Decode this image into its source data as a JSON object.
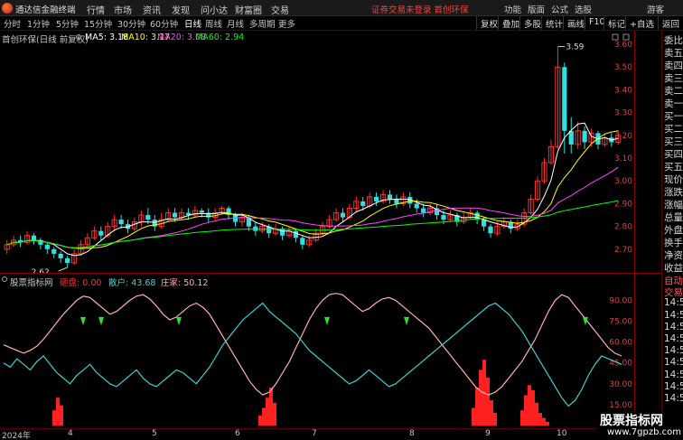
{
  "app": {
    "name": "通达信金融终端"
  },
  "menu": [
    "行情",
    "市场",
    "资讯",
    "发现",
    "问小达",
    "财富圈",
    "交易"
  ],
  "notice": "证券交易未登录  首创环保",
  "sys_buttons": [
    "功能",
    "版面",
    "公式",
    "选股",
    "游客"
  ],
  "periods": [
    "分时",
    "1分钟",
    "5分钟",
    "15分钟",
    "30分钟",
    "60分钟",
    "日线",
    "周线",
    "月线",
    "多周期",
    "更多"
  ],
  "active_period": "日线",
  "tools": [
    "复权",
    "叠加",
    "多股",
    "统计",
    "画线",
    "F10",
    "标记",
    "+自选",
    "返回"
  ],
  "stock": {
    "label": "首创环保(日线 前复权)"
  },
  "ma": [
    {
      "name": "MA5",
      "value": "3.18",
      "color": "#ffffff"
    },
    {
      "name": "MA10",
      "value": "3.17",
      "color": "#ffff00"
    },
    {
      "name": "MA20",
      "value": "3.08",
      "color": "#ff44ff"
    },
    {
      "name": "MA60",
      "value": "2.94",
      "color": "#00ff00"
    }
  ],
  "price_axis": [
    "3.60",
    "3.50",
    "3.40",
    "3.30",
    "3.20",
    "3.10",
    "3.00",
    "2.90",
    "2.80",
    "2.70"
  ],
  "annotations": {
    "high": "3.59",
    "low": "2.62"
  },
  "indicator": {
    "name": "股票指标网",
    "items": [
      {
        "name": "砸盘",
        "value": "0.00",
        "color": "#ff3030"
      },
      {
        "name": "散户",
        "value": "43.68",
        "color": "#40d0d0"
      },
      {
        "name": "庄家",
        "value": "50.12",
        "color": "#ffb0b0"
      }
    ],
    "axis": [
      "90.00",
      "75.00",
      "60.00",
      "45.00",
      "30.00",
      "15.00"
    ]
  },
  "right_column": [
    "委比",
    "卖五",
    "卖四",
    "卖三",
    "卖二",
    "卖一",
    "买一",
    "买二",
    "买三",
    "买四",
    "买五",
    "现价",
    "涨跌",
    "涨幅",
    "总量",
    "外盘",
    "换手",
    "净资",
    "收益",
    "自动",
    "交易",
    "14:50",
    "14:50",
    "14:50",
    "14:50",
    "14:50",
    "14:50",
    "14:50",
    "14:50",
    "14:50"
  ],
  "bottom": {
    "year": "2024年",
    "dates": [
      "4",
      "5",
      "6",
      "7",
      "8",
      "9",
      "10"
    ]
  },
  "watermark": {
    "title": "股票指标网",
    "url": "www.7gpzb.com"
  },
  "chart_data": {
    "type": "candlestick",
    "price_range": [
      2.62,
      3.62
    ],
    "high_label": 3.59,
    "low_label": 2.62,
    "candles": [
      [
        2.7,
        2.72,
        2.68,
        2.74
      ],
      [
        2.72,
        2.74,
        2.71,
        2.76
      ],
      [
        2.74,
        2.73,
        2.71,
        2.76
      ],
      [
        2.73,
        2.76,
        2.72,
        2.78
      ],
      [
        2.76,
        2.74,
        2.72,
        2.77
      ],
      [
        2.74,
        2.72,
        2.7,
        2.75
      ],
      [
        2.72,
        2.7,
        2.68,
        2.73
      ],
      [
        2.7,
        2.68,
        2.66,
        2.71
      ],
      [
        2.68,
        2.66,
        2.64,
        2.69
      ],
      [
        2.66,
        2.64,
        2.62,
        2.67
      ],
      [
        2.64,
        2.68,
        2.63,
        2.7
      ],
      [
        2.68,
        2.72,
        2.67,
        2.74
      ],
      [
        2.72,
        2.75,
        2.71,
        2.77
      ],
      [
        2.75,
        2.78,
        2.74,
        2.8
      ],
      [
        2.78,
        2.76,
        2.74,
        2.8
      ],
      [
        2.76,
        2.8,
        2.75,
        2.82
      ],
      [
        2.8,
        2.83,
        2.78,
        2.85
      ],
      [
        2.83,
        2.81,
        2.79,
        2.85
      ],
      [
        2.81,
        2.79,
        2.77,
        2.83
      ],
      [
        2.79,
        2.82,
        2.78,
        2.84
      ],
      [
        2.82,
        2.85,
        2.8,
        2.87
      ],
      [
        2.85,
        2.83,
        2.81,
        2.88
      ],
      [
        2.83,
        2.8,
        2.78,
        2.85
      ],
      [
        2.8,
        2.83,
        2.79,
        2.86
      ],
      [
        2.83,
        2.86,
        2.82,
        2.88
      ],
      [
        2.86,
        2.84,
        2.82,
        2.88
      ],
      [
        2.84,
        2.86,
        2.83,
        2.88
      ],
      [
        2.86,
        2.85,
        2.83,
        2.88
      ],
      [
        2.85,
        2.87,
        2.84,
        2.89
      ],
      [
        2.87,
        2.86,
        2.84,
        2.88
      ],
      [
        2.86,
        2.84,
        2.82,
        2.88
      ],
      [
        2.84,
        2.86,
        2.83,
        2.88
      ],
      [
        2.86,
        2.88,
        2.85,
        2.89
      ],
      [
        2.88,
        2.85,
        2.83,
        2.89
      ],
      [
        2.85,
        2.82,
        2.8,
        2.86
      ],
      [
        2.82,
        2.84,
        2.8,
        2.86
      ],
      [
        2.84,
        2.8,
        2.78,
        2.85
      ],
      [
        2.8,
        2.78,
        2.76,
        2.82
      ],
      [
        2.78,
        2.8,
        2.77,
        2.82
      ],
      [
        2.8,
        2.77,
        2.75,
        2.81
      ],
      [
        2.77,
        2.79,
        2.76,
        2.81
      ],
      [
        2.79,
        2.76,
        2.74,
        2.8
      ],
      [
        2.76,
        2.78,
        2.75,
        2.8
      ],
      [
        2.78,
        2.75,
        2.73,
        2.79
      ],
      [
        2.75,
        2.72,
        2.7,
        2.76
      ],
      [
        2.72,
        2.74,
        2.71,
        2.76
      ],
      [
        2.74,
        2.77,
        2.73,
        2.79
      ],
      [
        2.77,
        2.8,
        2.76,
        2.82
      ],
      [
        2.8,
        2.83,
        2.79,
        2.85
      ],
      [
        2.83,
        2.86,
        2.82,
        2.88
      ],
      [
        2.86,
        2.84,
        2.82,
        2.88
      ],
      [
        2.84,
        2.88,
        2.83,
        2.9
      ],
      [
        2.88,
        2.91,
        2.86,
        2.93
      ],
      [
        2.91,
        2.89,
        2.87,
        2.93
      ],
      [
        2.89,
        2.93,
        2.88,
        2.95
      ],
      [
        2.93,
        2.91,
        2.89,
        2.95
      ],
      [
        2.91,
        2.94,
        2.9,
        2.96
      ],
      [
        2.94,
        2.92,
        2.9,
        2.96
      ],
      [
        2.92,
        2.9,
        2.88,
        2.94
      ],
      [
        2.9,
        2.93,
        2.89,
        2.95
      ],
      [
        2.93,
        2.9,
        2.88,
        2.95
      ],
      [
        2.9,
        2.88,
        2.86,
        2.92
      ],
      [
        2.88,
        2.86,
        2.84,
        2.9
      ],
      [
        2.86,
        2.88,
        2.85,
        2.9
      ],
      [
        2.88,
        2.85,
        2.83,
        2.9
      ],
      [
        2.85,
        2.83,
        2.81,
        2.87
      ],
      [
        2.83,
        2.85,
        2.82,
        2.87
      ],
      [
        2.85,
        2.82,
        2.8,
        2.86
      ],
      [
        2.82,
        2.84,
        2.81,
        2.86
      ],
      [
        2.84,
        2.86,
        2.83,
        2.88
      ],
      [
        2.86,
        2.83,
        2.81,
        2.87
      ],
      [
        2.83,
        2.8,
        2.78,
        2.84
      ],
      [
        2.8,
        2.77,
        2.75,
        2.81
      ],
      [
        2.77,
        2.8,
        2.76,
        2.82
      ],
      [
        2.8,
        2.82,
        2.79,
        2.84
      ],
      [
        2.82,
        2.79,
        2.77,
        2.83
      ],
      [
        2.79,
        2.81,
        2.78,
        2.83
      ],
      [
        2.81,
        2.86,
        2.8,
        2.88
      ],
      [
        2.86,
        2.92,
        2.85,
        2.94
      ],
      [
        2.92,
        3.0,
        2.91,
        3.02
      ],
      [
        3.0,
        3.08,
        2.99,
        3.1
      ],
      [
        3.08,
        3.15,
        3.07,
        3.18
      ],
      [
        3.15,
        3.5,
        3.14,
        3.59
      ],
      [
        3.5,
        3.22,
        3.12,
        3.52
      ],
      [
        3.22,
        3.16,
        3.12,
        3.28
      ],
      [
        3.16,
        3.22,
        3.14,
        3.26
      ],
      [
        3.22,
        3.17,
        3.14,
        3.24
      ],
      [
        3.17,
        3.21,
        3.15,
        3.23
      ],
      [
        3.21,
        3.16,
        3.14,
        3.22
      ],
      [
        3.16,
        3.19,
        3.15,
        3.21
      ],
      [
        3.19,
        3.17,
        3.15,
        3.21
      ],
      [
        3.17,
        3.2,
        3.16,
        3.22
      ]
    ],
    "series": [
      {
        "name": "MA5",
        "color": "#ffffff"
      },
      {
        "name": "MA10",
        "color": "#ffff00"
      },
      {
        "name": "MA20",
        "color": "#ff44ff"
      },
      {
        "name": "MA60",
        "color": "#00ff00"
      }
    ],
    "indicator_range": [
      0,
      100
    ],
    "indicator_series": [
      {
        "name": "庄家",
        "color": "#ffb0b0",
        "values": [
          58,
          56,
          54,
          52,
          54,
          57,
          62,
          68,
          74,
          80,
          85,
          90,
          93,
          92,
          88,
          84,
          80,
          82,
          86,
          90,
          93,
          94,
          91,
          86,
          80,
          76,
          78,
          82,
          86,
          88,
          85,
          80,
          72,
          64,
          56,
          48,
          40,
          32,
          26,
          22,
          24,
          30,
          38,
          46,
          56,
          66,
          76,
          84,
          90,
          94,
          95,
          94,
          90,
          86,
          82,
          84,
          88,
          91,
          92,
          90,
          86,
          82,
          78,
          74,
          70,
          64,
          58,
          52,
          46,
          40,
          34,
          28,
          24,
          22,
          24,
          28,
          34,
          40,
          46,
          54,
          62,
          72,
          82,
          90,
          94,
          92,
          86,
          80,
          74,
          68,
          62,
          56,
          52,
          50
        ]
      },
      {
        "name": "散户",
        "color": "#40d0d0",
        "values": [
          45,
          42,
          48,
          44,
          40,
          46,
          50,
          44,
          38,
          34,
          30,
          36,
          40,
          44,
          38,
          34,
          30,
          28,
          32,
          36,
          40,
          34,
          30,
          28,
          32,
          36,
          40,
          38,
          34,
          30,
          36,
          42,
          50,
          58,
          64,
          70,
          76,
          80,
          84,
          88,
          82,
          78,
          74,
          70,
          66,
          60,
          54,
          50,
          46,
          42,
          38,
          34,
          30,
          32,
          36,
          40,
          36,
          32,
          28,
          30,
          34,
          38,
          42,
          46,
          50,
          54,
          58,
          62,
          66,
          70,
          74,
          78,
          82,
          86,
          88,
          84,
          80,
          74,
          68,
          60,
          52,
          44,
          36,
          28,
          20,
          14,
          18,
          26,
          36,
          44,
          50,
          48,
          46,
          44
        ]
      },
      {
        "name": "砸盘",
        "color": "#ff3030",
        "values": [
          0,
          0,
          0,
          0,
          0,
          0,
          0,
          0,
          0,
          0,
          0,
          0,
          0,
          0,
          0,
          0,
          0,
          0,
          0,
          0,
          0,
          0,
          0,
          0,
          0,
          0,
          0,
          0,
          0,
          0,
          0,
          0,
          0,
          0,
          0,
          0,
          0,
          0,
          0,
          0,
          0,
          0,
          0,
          0,
          0,
          0,
          0,
          0,
          0,
          0,
          0,
          0,
          0,
          0,
          0,
          0,
          0,
          0,
          0,
          0,
          0,
          0,
          0,
          0,
          0,
          0,
          0,
          0,
          0,
          0,
          0,
          0,
          0,
          0,
          0,
          0,
          0,
          0,
          0,
          0,
          0,
          0,
          0,
          0,
          0,
          0,
          0,
          0,
          0,
          0,
          0,
          0,
          0,
          0
        ]
      },
      {
        "name": "spikes",
        "color": "#ff2020",
        "values": [
          0,
          0,
          0,
          0,
          0,
          0,
          0,
          0,
          0,
          0,
          0,
          0,
          0,
          0,
          0,
          0,
          0,
          0,
          0,
          0,
          0,
          0,
          0,
          0,
          0,
          0,
          0,
          0,
          0,
          0,
          0,
          0,
          0,
          0,
          0,
          0,
          0,
          0,
          0,
          0,
          0,
          0,
          0,
          0,
          0,
          0,
          0,
          0,
          0,
          0,
          0,
          0,
          0,
          0,
          0,
          0,
          0,
          0,
          0,
          0,
          0,
          0,
          0,
          0,
          0,
          0,
          0,
          0,
          0,
          0,
          0,
          0,
          0,
          0,
          0,
          0,
          0,
          0,
          0,
          0,
          0,
          0,
          0,
          0,
          0,
          0,
          0,
          0,
          0,
          0,
          0,
          0,
          0,
          0
        ]
      }
    ]
  }
}
